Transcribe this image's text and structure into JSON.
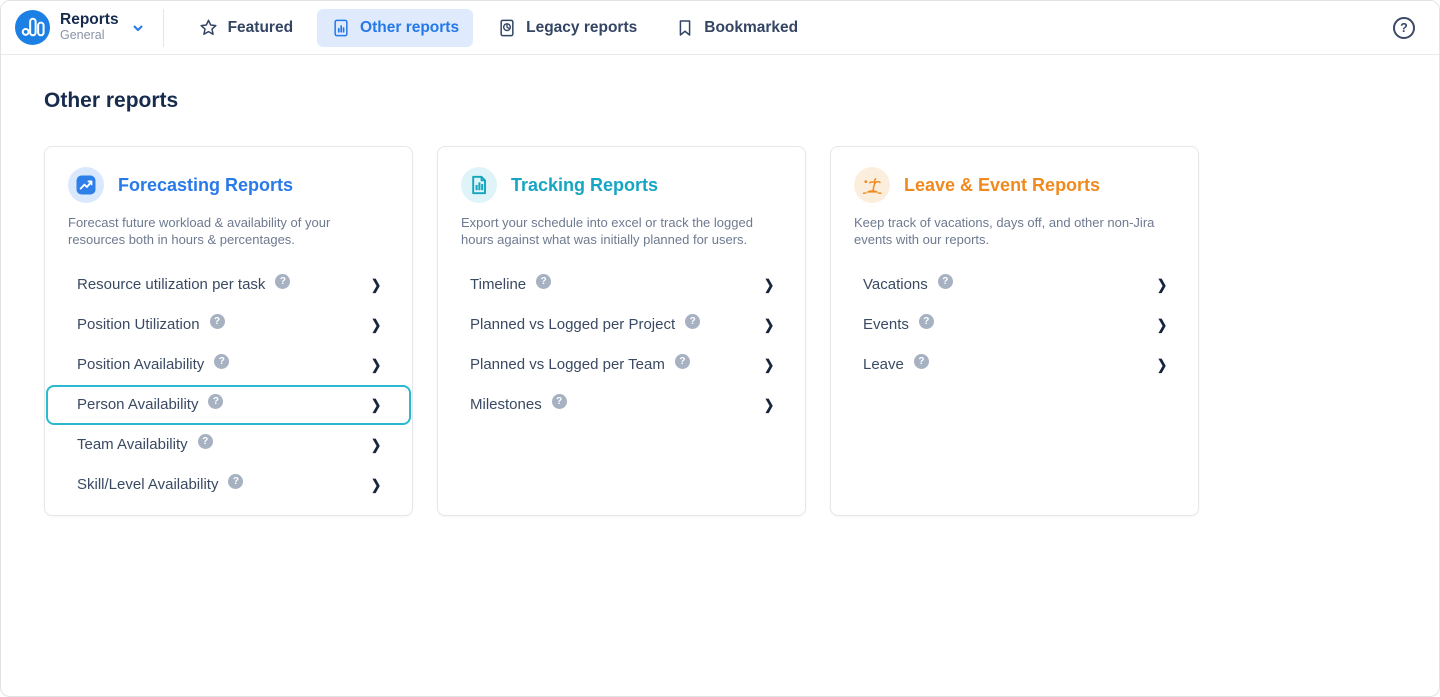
{
  "header": {
    "app": {
      "title": "Reports",
      "subtitle": "General"
    },
    "tabs": [
      {
        "label": "Featured",
        "icon": "star-icon",
        "active": false
      },
      {
        "label": "Other reports",
        "icon": "report-document-icon",
        "active": true
      },
      {
        "label": "Legacy reports",
        "icon": "legacy-report-icon",
        "active": false
      },
      {
        "label": "Bookmarked",
        "icon": "bookmark-icon",
        "active": false
      }
    ],
    "help_icon": "help-icon"
  },
  "page": {
    "title": "Other reports"
  },
  "icons": {
    "help_glyph": "?",
    "chevron_glyph": "❯"
  },
  "colors": {
    "accent_blue": "#2979e8",
    "accent_cyan": "#16a5c2",
    "accent_orange": "#f08a1e",
    "highlight_teal": "#2cb8cf",
    "active_tab_bg": "#dfebfc",
    "nav_text": "#344563",
    "logo_blue": "#1b7fe4"
  },
  "cards": [
    {
      "title": "Forecasting Reports",
      "icon": "trend-up-icon",
      "description": "Forecast future workload & availability of your resources both in hours & percentages.",
      "items": [
        {
          "label": "Resource utilization per task",
          "highlighted": false
        },
        {
          "label": "Position Utilization",
          "highlighted": false
        },
        {
          "label": "Position Availability",
          "highlighted": false
        },
        {
          "label": "Person Availability",
          "highlighted": true
        },
        {
          "label": "Team Availability",
          "highlighted": false
        },
        {
          "label": "Skill/Level Availability",
          "highlighted": false
        }
      ]
    },
    {
      "title": "Tracking Reports",
      "icon": "document-chart-icon",
      "description": "Export your schedule into excel or track the logged hours against what was initially planned for users.",
      "items": [
        {
          "label": "Timeline",
          "highlighted": false
        },
        {
          "label": "Planned vs Logged per Project",
          "highlighted": false
        },
        {
          "label": "Planned vs Logged per Team",
          "highlighted": false
        },
        {
          "label": "Milestones",
          "highlighted": false
        }
      ]
    },
    {
      "title": "Leave & Event Reports",
      "icon": "palm-island-icon",
      "description": "Keep track of vacations, days off, and other non-Jira events with our reports.",
      "items": [
        {
          "label": "Vacations",
          "highlighted": false
        },
        {
          "label": "Events",
          "highlighted": false
        },
        {
          "label": "Leave",
          "highlighted": false
        }
      ]
    }
  ]
}
